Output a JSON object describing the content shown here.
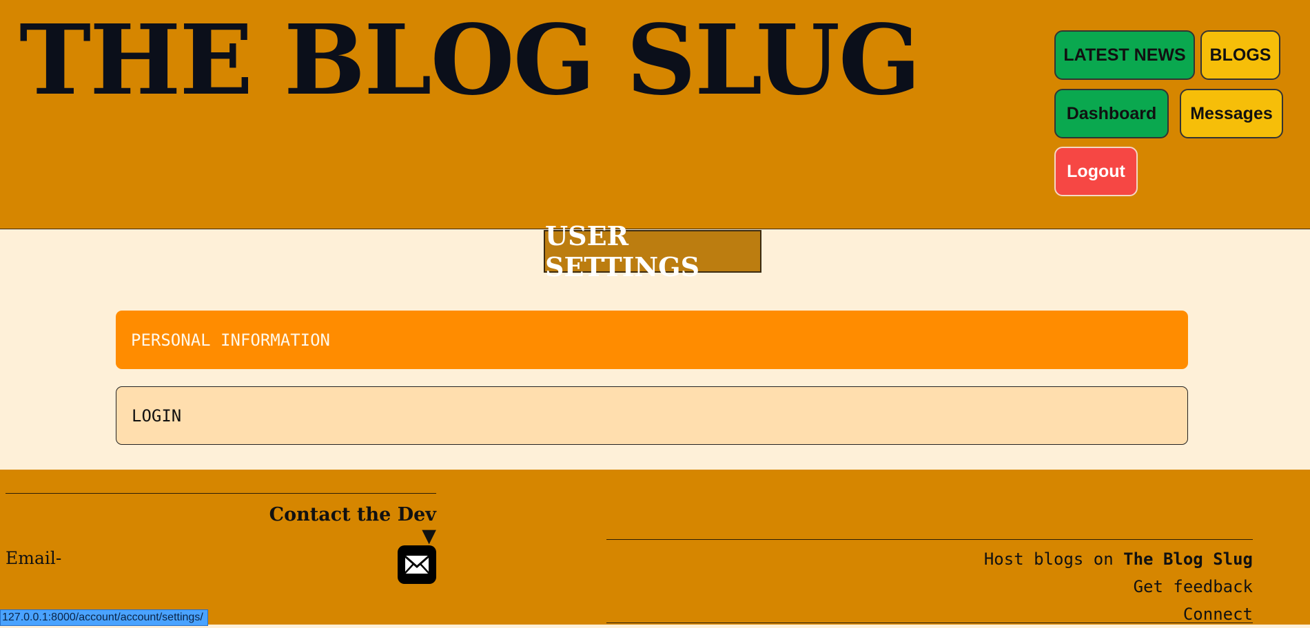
{
  "header": {
    "title": "THE BLOG SLUG",
    "nav": {
      "latest_news": "LATEST NEWS",
      "blogs": "BLOGS",
      "dashboard": "Dashboard",
      "messages": "Messages",
      "logout": "Logout"
    }
  },
  "main": {
    "heading": "USER SETTINGS",
    "panels": [
      "PERSONAL INFORMATION",
      "LOGIN"
    ]
  },
  "footer": {
    "contact_heading": "Contact the Dev ▼",
    "email_label": "Email-",
    "links": {
      "host_prefix": "Host blogs on",
      "host_brand": "The Blog Slug",
      "feedback": "Get feedback",
      "connect": "Connect"
    }
  },
  "status_bar": {
    "url": "127.0.0.1:8000/account/account/settings/"
  },
  "colors": {
    "header_bg": "#d68600",
    "page_bg": "#fef0d8",
    "green_button": "#0aa84f",
    "yellow_button": "#f6be09",
    "logout_button": "#f64744",
    "panel_active": "#ff8c00",
    "panel_inactive": "#ffdeae"
  },
  "icons": {
    "email": "envelope-icon"
  }
}
